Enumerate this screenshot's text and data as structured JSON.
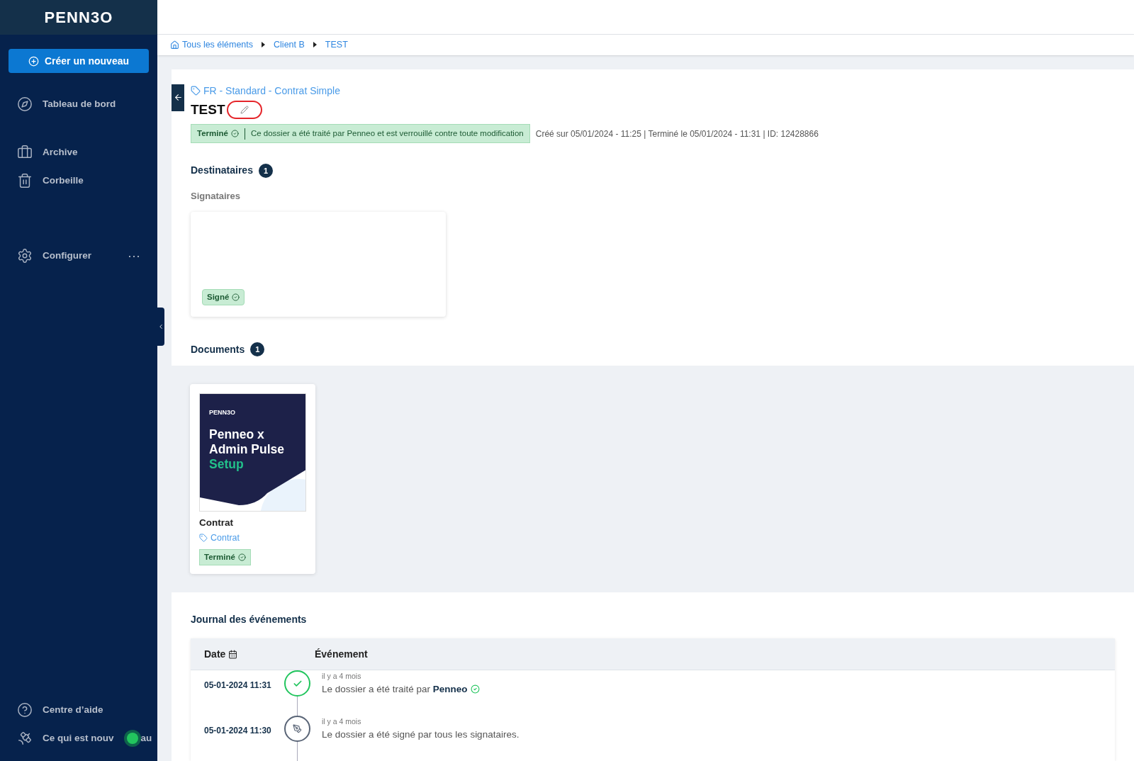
{
  "sidebar": {
    "logo": "PENN3O",
    "create_button": "Créer un nouveau",
    "items": [
      {
        "label": "Tableau de bord"
      },
      {
        "label": "Archive"
      },
      {
        "label": "Corbeille"
      },
      {
        "label": "Configurer",
        "more": "···"
      }
    ],
    "bottom_items": [
      {
        "label": "Centre d’aide",
        "badge": false
      },
      {
        "label": "Ce qui est nouv",
        "label_tail": "au",
        "badge": true
      }
    ]
  },
  "breadcrumb": [
    {
      "label": "Tous les éléments",
      "home": true
    },
    {
      "label": "Client B",
      "home": false
    },
    {
      "label": "TEST",
      "home": false
    }
  ],
  "case": {
    "template": "FR - Standard - Contrat Simple",
    "title": "TEST",
    "annotated": true,
    "status": "Terminé",
    "status_message": "Ce dossier a été traité par Penneo et est verrouillé contre toute modification",
    "meta": "Créé sur 05/01/2024 - 11:25 | Terminé le 05/01/2024 - 11:31 | ID: 12428866"
  },
  "recipients": {
    "heading": "Destinataires",
    "count": "1",
    "subheading": "Signataires",
    "signers": [
      {
        "status": "Signé",
        "signed": true
      }
    ]
  },
  "documents": {
    "heading": "Documents",
    "count": "1",
    "items": [
      {
        "thumb_logo": "PENN3O",
        "thumb_lines": [
          "Penneo x",
          "Admin Pulse"
        ],
        "thumb_accent": "Setup",
        "name": "Contrat",
        "tag": "Contrat",
        "status": "Terminé"
      }
    ]
  },
  "journal": {
    "heading": "Journal des événements",
    "columns": [
      "Date",
      "Événement"
    ],
    "events": [
      {
        "kind": "processed",
        "date": "05-01-2024 11:31",
        "ago": "il y a 4 mois",
        "text": "Le dossier a été traité par **Penneo**"
      },
      {
        "kind": "signed",
        "date": "05-01-2024 11:30",
        "ago": "il y a 4 mois",
        "text": "Le dossier a été signé par tous les signataires."
      }
    ]
  }
}
